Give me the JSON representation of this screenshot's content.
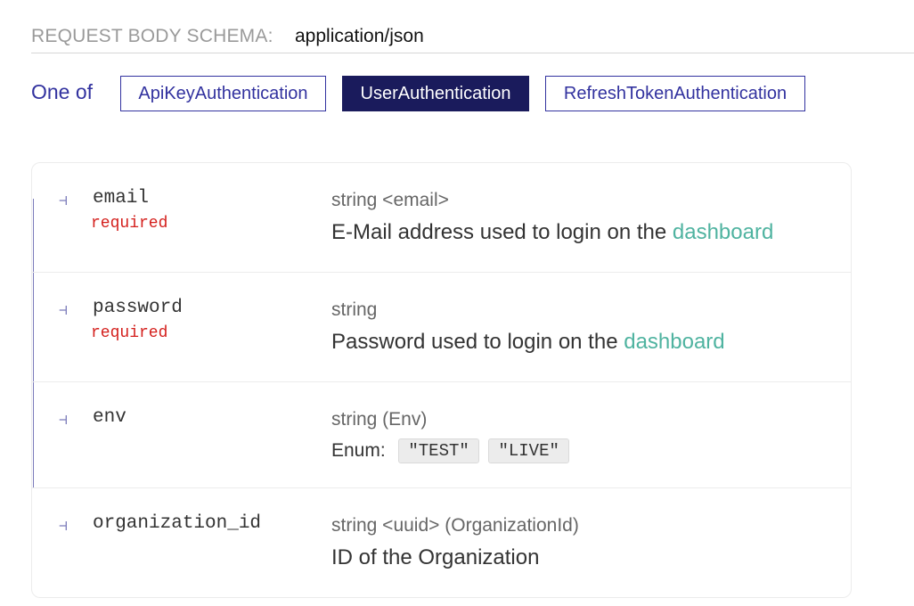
{
  "header": {
    "label": "REQUEST BODY SCHEMA:",
    "content_type": "application/json"
  },
  "one_of": {
    "label": "One of",
    "variants": [
      "ApiKeyAuthentication",
      "UserAuthentication",
      "RefreshTokenAuthentication"
    ],
    "selected": "UserAuthentication"
  },
  "properties": [
    {
      "name": "email",
      "required_label": "required",
      "type": "string <email>",
      "description_prefix": "E-Mail address used to login on the ",
      "description_link": "dashboard"
    },
    {
      "name": "password",
      "required_label": "required",
      "type": "string",
      "description_prefix": "Password used to login on the ",
      "description_link": "dashboard"
    },
    {
      "name": "env",
      "type": "string (Env)",
      "enum_label": "Enum:",
      "enum_values": [
        "\"TEST\"",
        "\"LIVE\""
      ]
    },
    {
      "name": "organization_id",
      "type": "string <uuid> (OrganizationId)",
      "description": "ID of the Organization"
    }
  ],
  "icons": {
    "property_branch": "tree-branch-icon"
  },
  "colors": {
    "accent": "#32329f",
    "selected_bg": "#1a1b5c",
    "required": "#d41f1c",
    "link": "#4fb3a0",
    "tree_line": "#7c7cbb"
  }
}
